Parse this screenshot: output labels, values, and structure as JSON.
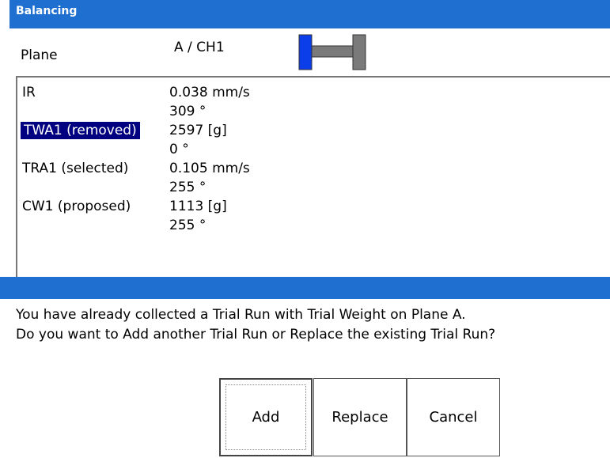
{
  "window": {
    "title": "Balancing"
  },
  "plane": {
    "label": "Plane",
    "value": "A / CH1"
  },
  "colors": {
    "titlebar": "#1f6fd0",
    "selection": "#000080",
    "plane_active": "#0b3de8",
    "plane_inactive": "#7a7a7a"
  },
  "rows": [
    {
      "label": "IR",
      "value1": "0.038 mm/s",
      "value2": "309 °"
    },
    {
      "label": "TWA1 (removed)",
      "value1": "2597 [g]",
      "value2": "0 °",
      "selected": true
    },
    {
      "label": "TRA1 (selected)",
      "value1": "0.105 mm/s",
      "value2": "255 °"
    },
    {
      "label": "CW1 (proposed)",
      "value1": "1113 [g]",
      "value2": "255 °"
    }
  ],
  "dialog": {
    "line1": "You have already collected a Trial Run with Trial Weight on Plane A.",
    "line2": "Do you want to Add another Trial Run or Replace the existing Trial Run?",
    "buttons": {
      "add": "Add",
      "replace": "Replace",
      "cancel": "Cancel"
    }
  }
}
